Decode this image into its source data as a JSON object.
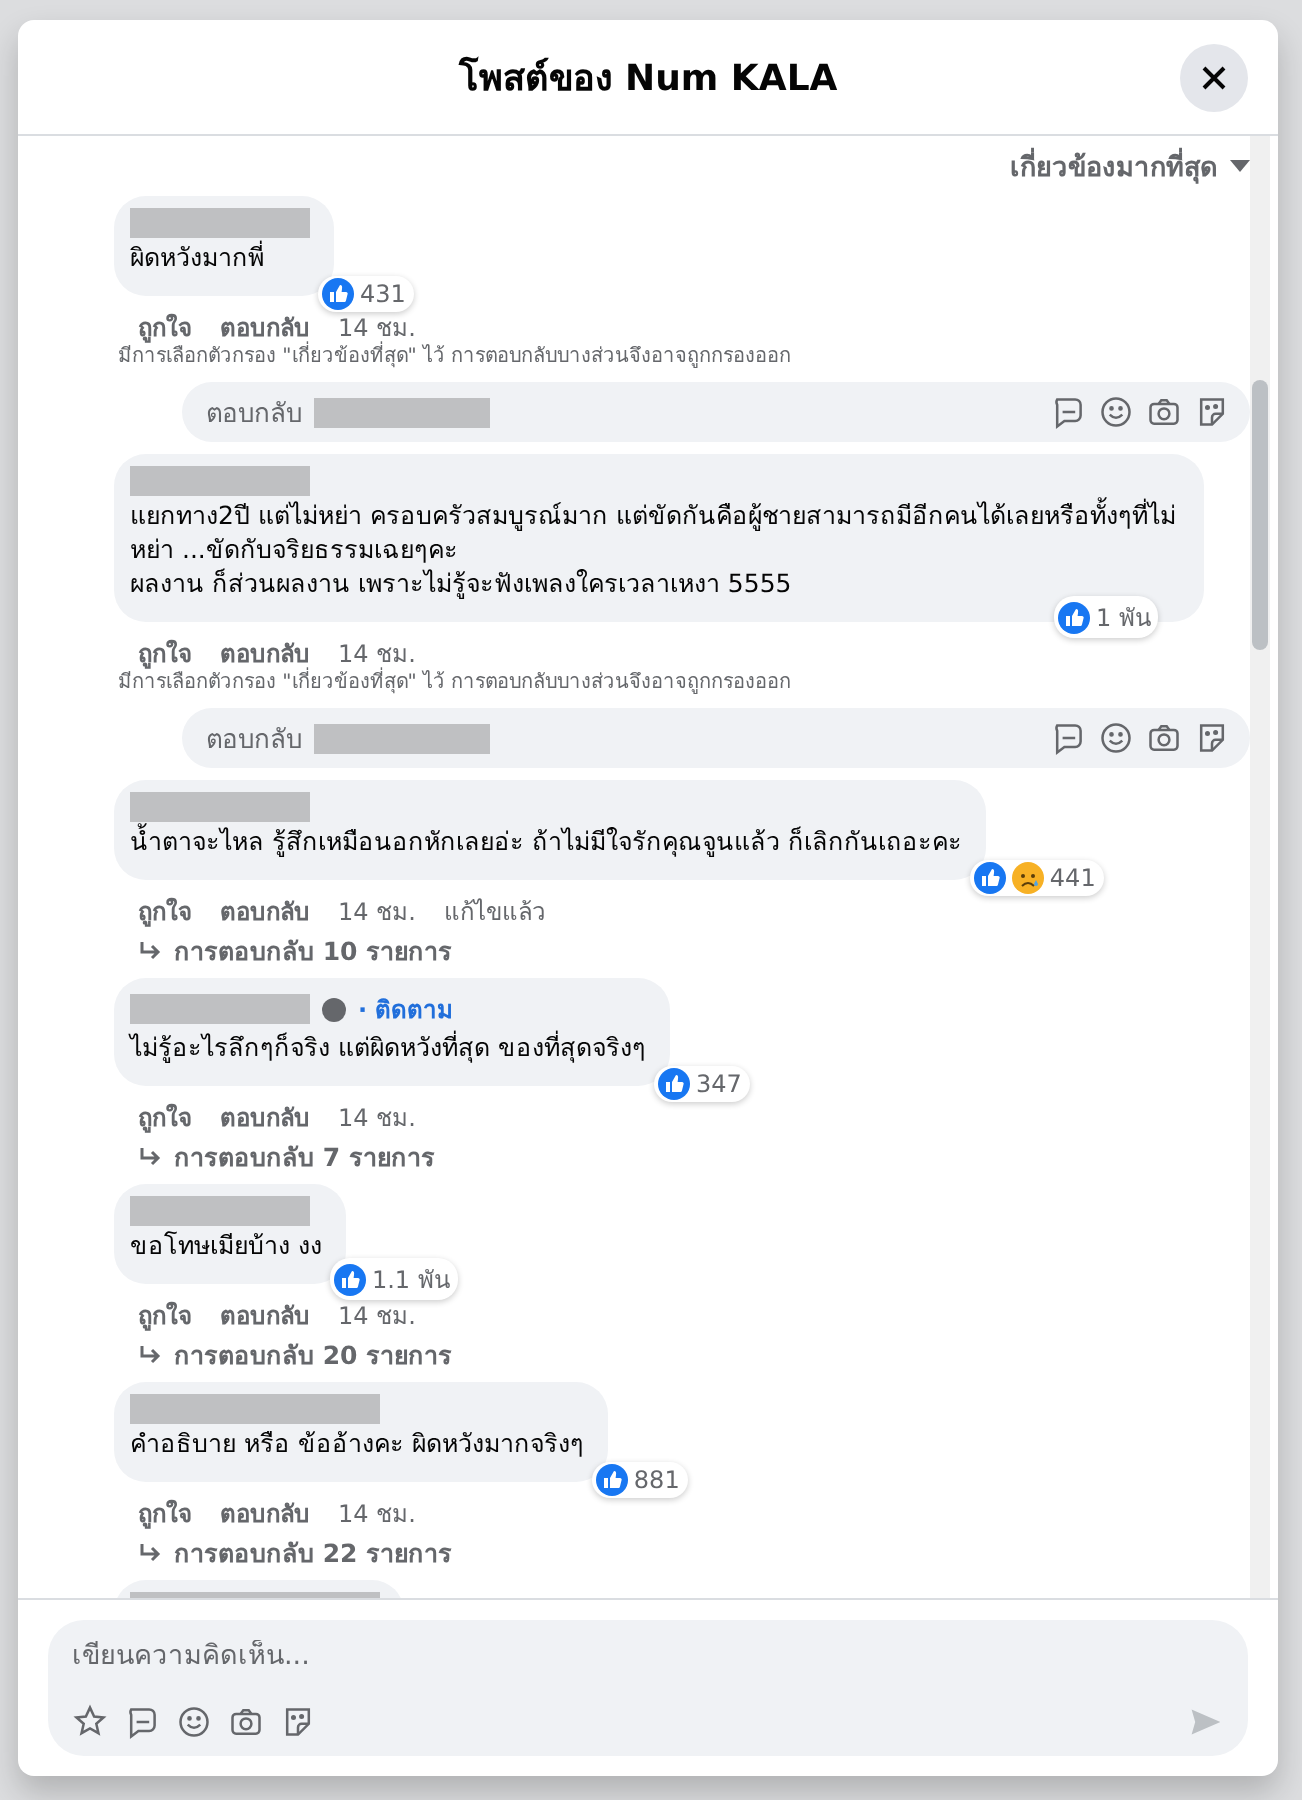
{
  "dialog": {
    "title": "โพสต์ของ Num KALA"
  },
  "sort": {
    "label": "เกี่ยวข้องมากที่สุด"
  },
  "comments": [
    {
      "text": "ผิดหวังมากพี่",
      "reactions": [
        {
          "kind": "like"
        }
      ],
      "reaction_count": "431",
      "actions": [
        "ถูกใจ",
        "ตอบกลับ"
      ],
      "time": "14 ชม.",
      "filter_note": "มีการเลือกตัวกรอง \"เกี่ยวข้องที่สุด\" ไว้ การตอบกลับบางส่วนจึงอาจถูกกรองออก",
      "reply_box": {
        "placeholder": "ตอบกลับ"
      }
    },
    {
      "text": "แยกทาง2ปี แต่ไม่หย่า ครอบครัวสมบูรณ์มาก แต่ขัดกันคือผู้ชายสามารถมีอีกคนได้เลยหรือทั้งๆที่ไม่หย่า ...ขัดกับจริยธรรมเฉยๆคะ\nผลงาน ก็ส่วนผลงาน เพราะไม่รู้จะฟังเพลงใครเวลาเหงา 5555",
      "reactions": [
        {
          "kind": "like"
        }
      ],
      "reaction_count": "1 พัน",
      "actions": [
        "ถูกใจ",
        "ตอบกลับ"
      ],
      "time": "14 ชม.",
      "filter_note": "มีการเลือกตัวกรอง \"เกี่ยวข้องที่สุด\" ไว้ การตอบกลับบางส่วนจึงอาจถูกกรองออก",
      "reply_box": {
        "placeholder": "ตอบกลับ"
      }
    },
    {
      "text": "น้ำตาจะไหล รู้สึกเหมือนอกหักเลยอ่ะ ถ้าไม่มีใจรักคุณจูนแล้ว ก็เลิกกันเถอะคะ",
      "reactions": [
        {
          "kind": "like"
        },
        {
          "kind": "sad"
        }
      ],
      "reaction_count": "441",
      "actions": [
        "ถูกใจ",
        "ตอบกลับ"
      ],
      "time": "14 ชม.",
      "edited": "แก้ไขแล้ว",
      "replies_link": "การตอบกลับ 10 รายการ"
    },
    {
      "text": "ไม่รู้อะไรลึกๆก็จริง แต่ผิดหวังที่สุด ของที่สุดจริงๆ",
      "follow": "· ติดตาม",
      "reactions": [
        {
          "kind": "like"
        }
      ],
      "reaction_count": "347",
      "actions": [
        "ถูกใจ",
        "ตอบกลับ"
      ],
      "time": "14 ชม.",
      "replies_link": "การตอบกลับ 7 รายการ"
    },
    {
      "text": "ขอโทษเมียบ้าง งง",
      "reactions": [
        {
          "kind": "like"
        }
      ],
      "reaction_count": "1.1 พัน",
      "actions": [
        "ถูกใจ",
        "ตอบกลับ"
      ],
      "time": "14 ชม.",
      "replies_link": "การตอบกลับ 20 รายการ"
    },
    {
      "text": "คำอธิบาย หรือ ข้ออ้างคะ ผิดหวังมากจริงๆ",
      "reactions": [
        {
          "kind": "like"
        }
      ],
      "reaction_count": "881",
      "actions": [
        "ถูกใจ",
        "ตอบกลับ"
      ],
      "time": "14 ชม.",
      "replies_link": "การตอบกลับ 22 รายการ"
    }
  ],
  "composer": {
    "placeholder": "เขียนความคิดเห็น..."
  }
}
